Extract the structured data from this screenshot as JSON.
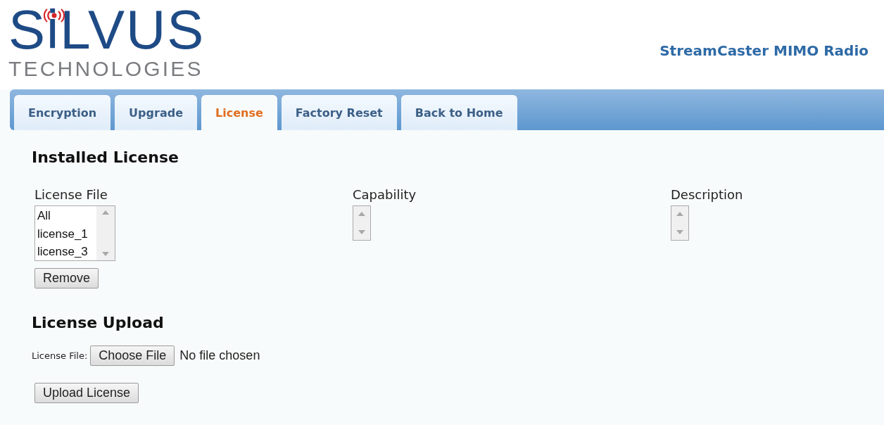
{
  "logo": {
    "name": "SiLVUS",
    "subtitle": "TECHNOLOGIES"
  },
  "product_title": "StreamCaster MIMO Radio",
  "tabs": [
    {
      "label": "Encryption",
      "selected": false
    },
    {
      "label": "Upgrade",
      "selected": false
    },
    {
      "label": "License",
      "selected": true
    },
    {
      "label": "Factory Reset",
      "selected": false
    },
    {
      "label": "Back to Home",
      "selected": false
    }
  ],
  "installed_license": {
    "heading": "Installed License",
    "columns": [
      {
        "label": "License File",
        "items": [
          "All",
          "license_1",
          "license_3"
        ]
      },
      {
        "label": "Capability"
      },
      {
        "label": "Description"
      }
    ],
    "remove_button": "Remove"
  },
  "license_upload": {
    "heading": "License Upload",
    "file_label": "License File:",
    "choose_button": "Choose File",
    "file_status": "No file chosen",
    "upload_button": "Upload License"
  }
}
